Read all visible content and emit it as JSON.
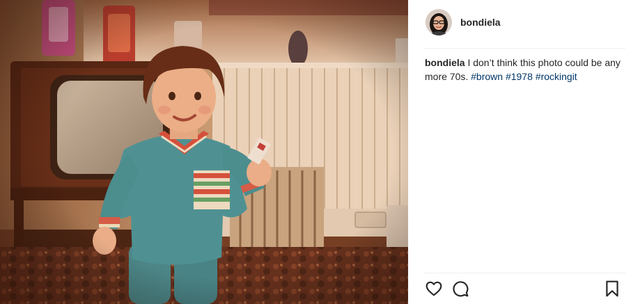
{
  "post": {
    "username": "bondiela",
    "caption": {
      "username": "bondiela",
      "text": " I don’t think this photo could be any more 70s. ",
      "hashtags": [
        "#brown",
        "#1978",
        "#rockingit"
      ]
    },
    "photo_icon": "vintage-photo-toddler"
  },
  "actions": {
    "like_icon": "heart-icon",
    "comment_icon": "comment-icon",
    "save_icon": "bookmark-icon"
  },
  "colors": {
    "text": "#262626",
    "hashtag": "#003569",
    "divider": "#efefef",
    "photo_tone": "#6b3a24"
  }
}
